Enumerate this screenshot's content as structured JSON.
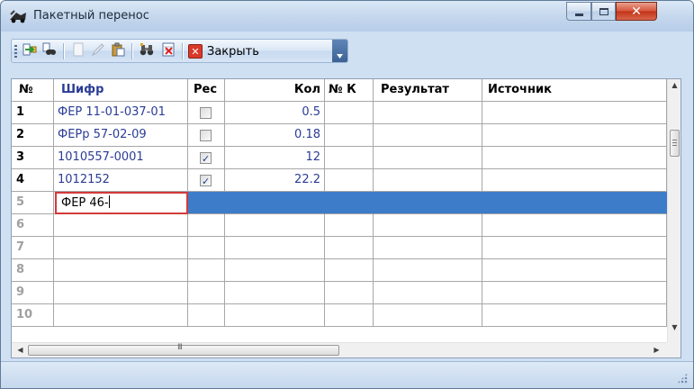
{
  "window": {
    "title": "Пакетный перенос",
    "icon": "truck-icon"
  },
  "toolbar": {
    "close_label": "Закрыть",
    "buttons": [
      "import-icon",
      "find-icon",
      "blank-icon",
      "edit-icon",
      "paste-icon",
      "binoculars-icon",
      "delete-icon"
    ]
  },
  "grid": {
    "columns": {
      "num": "№",
      "code": "Шифр",
      "res": "Рес",
      "qty": "Кол",
      "nk": "№ К",
      "result": "Результат",
      "source": "Источник"
    },
    "rows": [
      {
        "num": "1",
        "code": "ФЕР 11-01-037-01",
        "res": false,
        "qty": "0.5"
      },
      {
        "num": "2",
        "code": "ФЕРр 57-02-09",
        "res": false,
        "qty": "0.18"
      },
      {
        "num": "3",
        "code": "1010557-0001",
        "res": true,
        "qty": "12"
      },
      {
        "num": "4",
        "code": "1012152",
        "res": true,
        "qty": "22.2"
      },
      {
        "num": "5",
        "code": "ФЕР 46-"
      },
      {
        "num": "6"
      },
      {
        "num": "7"
      },
      {
        "num": "8"
      },
      {
        "num": "9"
      },
      {
        "num": "10"
      }
    ]
  },
  "scrollbar": {
    "hscroll_glyph": "III"
  },
  "colors": {
    "selection": "#3d7cc9",
    "link_text": "#2a3c96",
    "editor_border": "#d33a3a"
  }
}
